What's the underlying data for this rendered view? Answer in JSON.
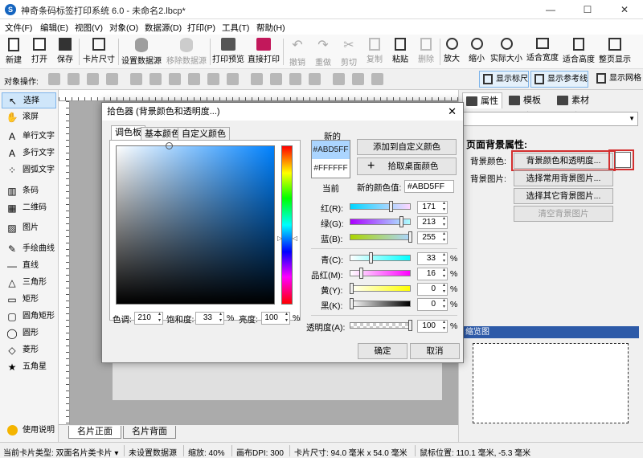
{
  "window": {
    "title": "神奇条码标签打印系统 6.0 - 未命名2.lbcp*",
    "minimize": "—",
    "maximize": "☐",
    "close": "✕"
  },
  "menu": [
    "文件(F)",
    "编辑(E)",
    "视图(V)",
    "对象(O)",
    "数据源(D)",
    "打印(P)",
    "工具(T)",
    "帮助(H)"
  ],
  "toolbar": {
    "new": "新建",
    "open": "打开",
    "save": "保存",
    "card_size": "卡片尺寸",
    "set_datasource": "设置数据源",
    "remove_datasource": "移除数据源",
    "print_preview": "打印预览",
    "print_direct": "直接打印",
    "undo": "撤销",
    "redo": "重做",
    "cut": "剪切",
    "copy": "复制",
    "paste": "粘贴",
    "delete": "删除",
    "zoom_in": "放大",
    "zoom_out": "缩小",
    "actual_size": "实际大小",
    "fit_width": "适合宽度",
    "fit_height": "适合高度",
    "whole_page": "整页显示"
  },
  "ops": {
    "label": "对象操作:",
    "show_ruler": "显示标尺",
    "show_guides": "显示参考线",
    "show_grid": "显示网格"
  },
  "tools": [
    {
      "label": "选择",
      "icon": "↖"
    },
    {
      "label": "滚屏",
      "icon": "✋"
    },
    {
      "label": "单行文字",
      "icon": "A"
    },
    {
      "label": "多行文字",
      "icon": "A"
    },
    {
      "label": "圆弧文字",
      "icon": "⁘"
    },
    {
      "label": "条码",
      "icon": "▥"
    },
    {
      "label": "二维码",
      "icon": "▦"
    },
    {
      "label": "图片",
      "icon": "▨"
    },
    {
      "label": "手绘曲线",
      "icon": "✎"
    },
    {
      "label": "直线",
      "icon": "—"
    },
    {
      "label": "三角形",
      "icon": "△"
    },
    {
      "label": "矩形",
      "icon": "▭"
    },
    {
      "label": "圆角矩形",
      "icon": "▢"
    },
    {
      "label": "圆形",
      "icon": "◯"
    },
    {
      "label": "菱形",
      "icon": "◇"
    },
    {
      "label": "五角星",
      "icon": "★"
    }
  ],
  "help": "使用说明",
  "page_tabs": [
    "名片正面",
    "名片背面"
  ],
  "right": {
    "tabs": [
      "属性栏",
      "模板库",
      "素材库"
    ],
    "section_title": "页面背景属性:",
    "bg_color_label": "背景颜色:",
    "bg_image_label": "背景图片:",
    "bg_color_btn": "背景颜色和透明度...",
    "common_bg_btn": "选择常用背景图片...",
    "other_bg_btn": "选择其它背景图片...",
    "clear_bg_btn": "清空背景图片",
    "preview_title": "缩览图"
  },
  "status": {
    "card_type": "当前卡片类型: 双面名片类卡片 ▾",
    "datasource": "未设置数据源",
    "zoom": "缩放: 40%",
    "dpi": "画布DPI: 300",
    "card_size": "卡片尺寸: 94.0 毫米 x 54.0 毫米",
    "mouse_pos": "鼠标位置: 110.1 毫米, -5.3 毫米"
  },
  "dialog": {
    "title": "拾色器 (背景颜色和透明度...)",
    "tabs": [
      "调色板",
      "基本颜色",
      "自定义颜色"
    ],
    "hue_label": "色调:",
    "hue": "210",
    "sat_label": "饱和度:",
    "sat": "33",
    "bri_label": "亮度:",
    "bri": "100",
    "pct": "%",
    "new_label": "新的",
    "current_label": "当前",
    "new_hex": "#ABD5FF",
    "current_hex": "#FFFFFF",
    "add_custom_btn": "添加到自定义颜色",
    "pick_screen_btn": "拾取桌面颜色",
    "new_value_label": "新的颜色值:",
    "new_value": "#ABD5FF",
    "r_label": "红(R):",
    "r": "171",
    "g_label": "绿(G):",
    "g": "213",
    "b_label": "蓝(B):",
    "b": "255",
    "c_label": "青(C):",
    "c": "33",
    "m_label": "品红(M):",
    "m": "16",
    "y_label": "黄(Y):",
    "y": "0",
    "k_label": "黑(K):",
    "k": "0",
    "alpha_label": "透明度(A):",
    "alpha": "100",
    "ok": "确定",
    "cancel": "取消"
  },
  "colors": {
    "new_color": "#ABD5FF",
    "current_color": "#FFFFFF",
    "highlight": "#D32F2F",
    "preview_header": "#2D5AA8"
  }
}
